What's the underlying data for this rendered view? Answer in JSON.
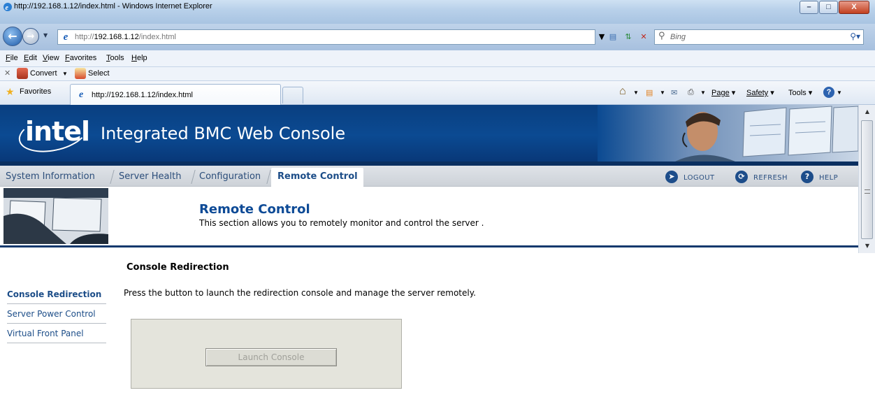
{
  "browser": {
    "window_title": "http://192.168.1.12/index.html - Windows Internet Explorer",
    "window_buttons": {
      "minimize": "–",
      "maximize": "□",
      "close": "X"
    },
    "address_prefix": "http://",
    "address_host": "192.168.1.12",
    "address_path": "/index.html",
    "search_placeholder": "Bing",
    "menu": [
      "File",
      "Edit",
      "View",
      "Favorites",
      "Tools",
      "Help"
    ],
    "command_bar": {
      "convert_label": "Convert",
      "select_label": "Select"
    },
    "favorites_label": "Favorites",
    "tab_label": "http://192.168.1.12/index.html",
    "commands": {
      "page": "Page",
      "safety": "Safety",
      "tools": "Tools"
    }
  },
  "banner": {
    "logo": "intel",
    "title": "Integrated BMC Web Console"
  },
  "nav": {
    "tabs": [
      "System Information",
      "Server Health",
      "Configuration",
      "Remote Control"
    ],
    "active_tab": "Remote Control",
    "utilities": {
      "logout": "LOGOUT",
      "refresh": "REFRESH",
      "help": "HELP"
    }
  },
  "section": {
    "title": "Remote Control",
    "description": "This section allows you to remotely monitor and control the server ."
  },
  "sidebar": {
    "items": [
      "Console Redirection",
      "Server Power Control",
      "Virtual Front Panel"
    ],
    "active_item": "Console Redirection"
  },
  "content": {
    "title": "Console Redirection",
    "instruction": "Press the button to launch the redirection console and manage the server remotely.",
    "button_label": "Launch Console",
    "button_enabled": false
  },
  "icons": {
    "logout": "power-icon",
    "refresh": "refresh-icon",
    "help": "help-icon",
    "favorites": "star-icon"
  },
  "colors": {
    "banner_blue": "#0b4a92",
    "link_blue": "#1c4d88",
    "title_blue": "#0d4a96"
  }
}
